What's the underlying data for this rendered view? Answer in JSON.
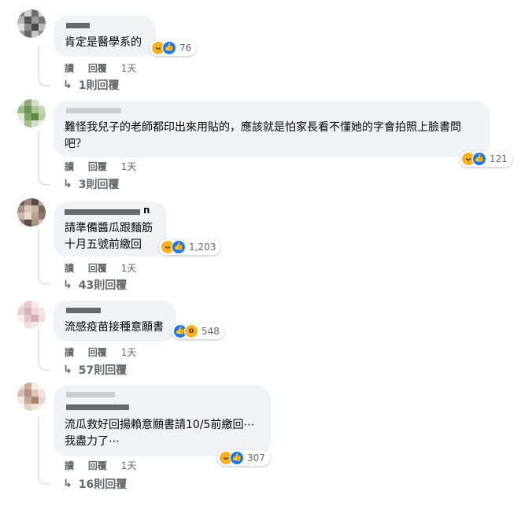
{
  "comments": [
    {
      "text_lines": [
        "肯定是醫學系的"
      ],
      "reactions": [
        "haha",
        "like"
      ],
      "reaction_count": "76",
      "actions": {
        "reply_a": "讀",
        "reply_b": "回覆",
        "time": "1天"
      },
      "replies_label": "1則回覆"
    },
    {
      "text_lines": [
        "難怪我兒子的老師都印出來用貼的，應該就是怕家長看不懂她的字會拍照上臉書問",
        "吧？"
      ],
      "reactions": [
        "haha",
        "like"
      ],
      "reaction_count": "121",
      "actions": {
        "reply_a": "讀",
        "reply_b": "回覆",
        "time": "1天"
      },
      "replies_label": "3則回覆"
    },
    {
      "name_suffix": "n",
      "text_lines": [
        "請準備醬瓜跟麵筋",
        "十月五號前繳回"
      ],
      "reactions": [
        "haha",
        "like"
      ],
      "reaction_count": "1,203",
      "actions": {
        "reply_a": "讀",
        "reply_b": "回覆",
        "time": "1天"
      },
      "replies_label": "43則回覆"
    },
    {
      "text_lines": [
        "流感疫苗接種意願書"
      ],
      "reactions": [
        "like",
        "wow"
      ],
      "reaction_count": "548",
      "actions": {
        "reply_a": "讀",
        "reply_b": "回覆",
        "time": "1天"
      },
      "replies_label": "57則回覆"
    },
    {
      "text_lines": [
        "流瓜救好回揚賴意願書請10/5前繳回⋯",
        "我盡力了⋯"
      ],
      "reactions": [
        "haha",
        "like"
      ],
      "reaction_count": "307",
      "actions": {
        "reply_a": "讀",
        "reply_b": "回覆",
        "time": "1天"
      },
      "replies_label": "16則回覆"
    }
  ],
  "icons": {
    "reply_arrow": "reply-arrow-icon",
    "haha": "haha-reaction-icon",
    "like": "like-reaction-icon",
    "wow": "wow-reaction-icon"
  }
}
